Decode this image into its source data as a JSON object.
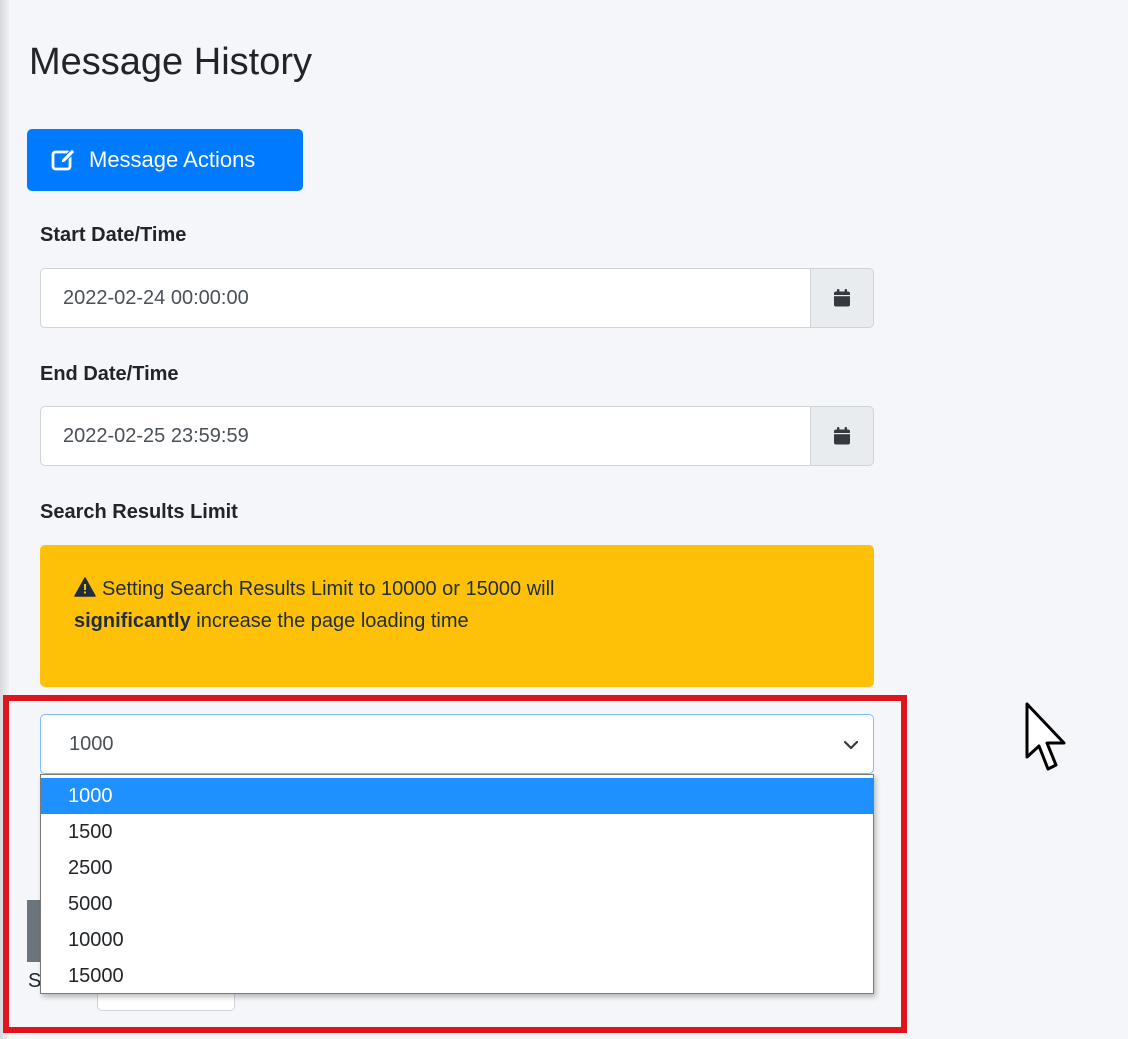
{
  "page": {
    "title": "Message History"
  },
  "actions_button": {
    "label": "Message Actions",
    "icon": "edit-icon",
    "color": "#007bff"
  },
  "start": {
    "label": "Start Date/Time",
    "value": "2022-02-24 00:00:00",
    "icon": "calendar-icon"
  },
  "end": {
    "label": "End Date/Time",
    "value": "2022-02-25 23:59:59",
    "icon": "calendar-icon"
  },
  "limit": {
    "label": "Search Results Limit",
    "warning": {
      "icon": "warning-triangle-icon",
      "text_before": "Setting Search Results Limit to 10000 or 15000 will",
      "bold": "significantly",
      "text_after": " increase the page loading time",
      "color": "#ffc107"
    },
    "selected": "1000",
    "options": [
      "1000",
      "1500",
      "2500",
      "5000",
      "10000",
      "15000"
    ]
  },
  "obscured": {
    "letter": "S"
  },
  "highlight": {
    "color": "#e0141e"
  },
  "cursor": {
    "icon": "mouse-pointer-icon"
  }
}
